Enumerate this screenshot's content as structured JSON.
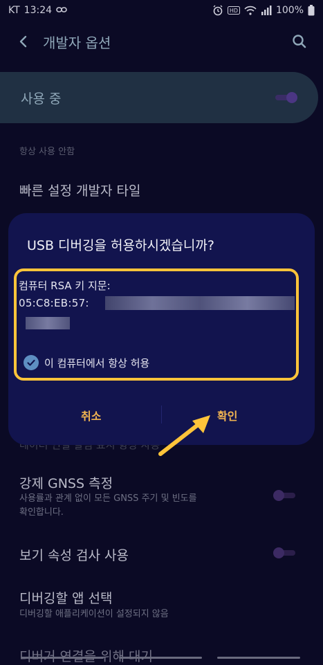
{
  "status_bar": {
    "carrier": "KT",
    "time": "13:24",
    "battery": "100%"
  },
  "header": {
    "title": "개발자 옵션"
  },
  "master_switch": {
    "label": "사용 중",
    "on": true
  },
  "settings": {
    "section_label": "항상 사용 안함",
    "quick_tiles": "빠른 설정 개발자 타일",
    "hidden_row": "데이터 연결 알림 표시 항상 사용",
    "gnss_title": "강제 GNSS 측정",
    "gnss_desc_1": "사용률과 관계 없이 모든 GNSS 주기 및 빈도를",
    "gnss_desc_2": "확인합니다.",
    "view_attr_title": "보기 속성 검사 사용",
    "debug_app_title": "디버깅할 앱 선택",
    "debug_app_desc": "디버깅할 애플리케이션이 설정되지 않음",
    "partial_row": "디버거 연결을 위해 대기"
  },
  "dialog": {
    "title": "USB 디버깅을 허용하시겠습니까?",
    "fingerprint_label": "컴퓨터 RSA 키 지문:",
    "fingerprint_value": "05:C8:EB:57:",
    "always_allow_label": "이 컴퓨터에서 항상 허용",
    "always_allow_checked": true,
    "cancel_label": "취소",
    "confirm_label": "확인"
  },
  "colors": {
    "background": "#0b0a25",
    "dialog": "#12144e",
    "highlight": "#ffc43a",
    "button_text": "#f1b451",
    "checkbox": "#5e8fc2"
  },
  "icons": [
    "back-icon",
    "search-icon",
    "alarm-icon",
    "hd-icon",
    "wifi-icon",
    "signal-icon",
    "link-icon",
    "check-icon",
    "arrow-annotation"
  ]
}
